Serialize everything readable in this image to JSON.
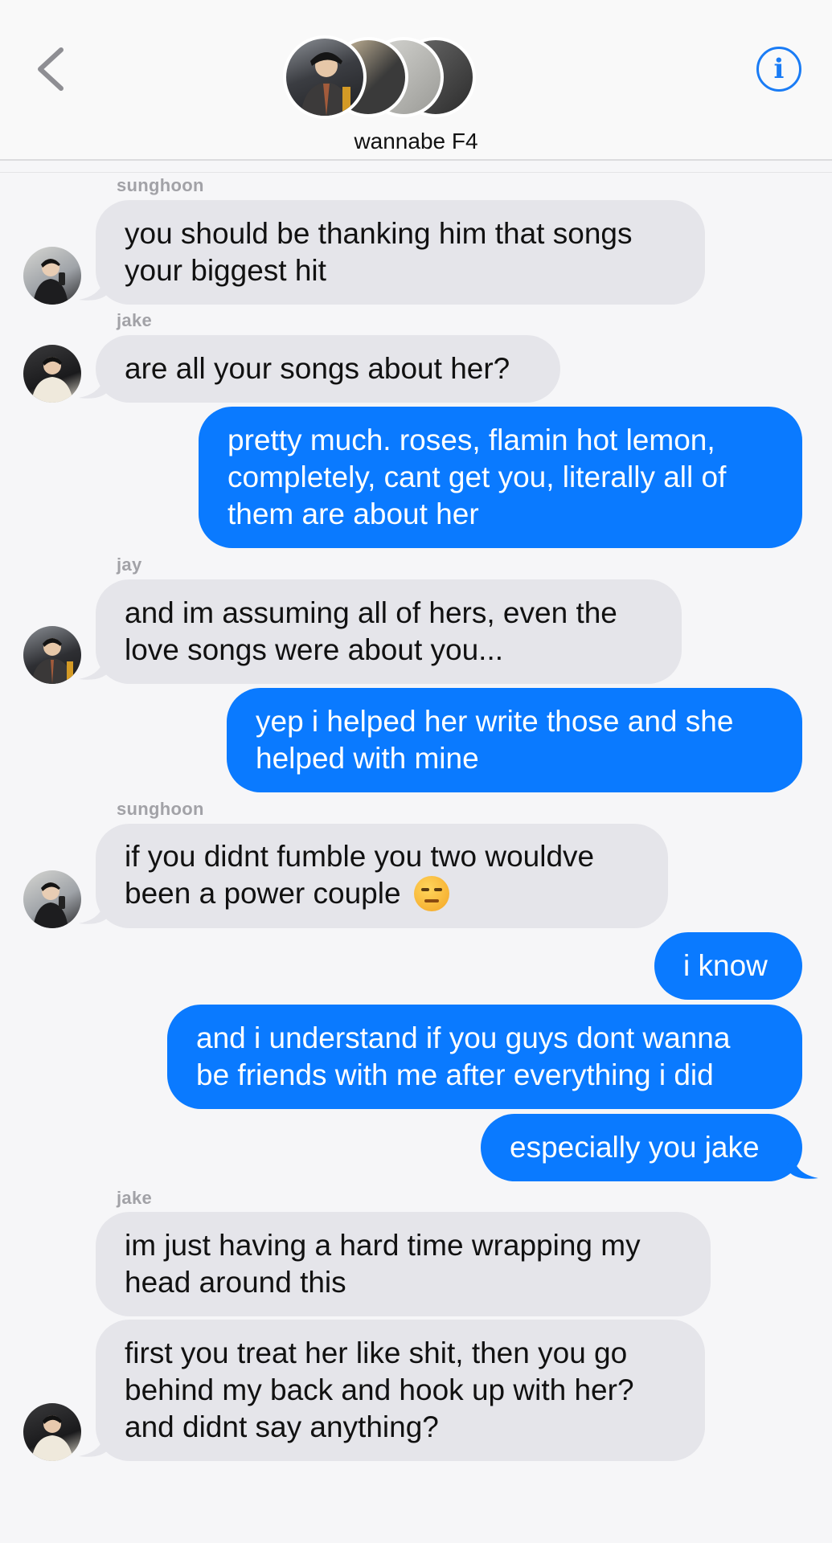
{
  "header": {
    "group_name": "wannabe F4",
    "back_icon": "chevron-left-icon",
    "info_icon": "info-icon",
    "info_glyph": "i",
    "accent_color": "#0a7aff",
    "group_avatar_count": 4
  },
  "messages": [
    {
      "sender": "sunghoon",
      "direction": "in",
      "lines": [
        "you should be thanking him that songs",
        "your biggest hit"
      ]
    },
    {
      "sender": "jake",
      "direction": "in",
      "lines": [
        "are all your songs about her?"
      ]
    },
    {
      "sender": "",
      "direction": "out",
      "lines": [
        "pretty much. roses, flamin hot lemon,",
        "completely, cant get you, literally all of",
        "them are about her"
      ]
    },
    {
      "sender": "jay",
      "direction": "in",
      "lines": [
        "and im assuming all of hers, even the",
        "love songs were about you..."
      ]
    },
    {
      "sender": "",
      "direction": "out",
      "lines": [
        "yep i helped her write those and she",
        "helped with mine"
      ]
    },
    {
      "sender": "sunghoon",
      "direction": "in",
      "lines": [
        "if you didnt fumble you two wouldve",
        "been a power couple"
      ],
      "emoji": "unamused-face-emoji"
    },
    {
      "sender": "",
      "direction": "out",
      "lines": [
        "i know"
      ]
    },
    {
      "sender": "",
      "direction": "out",
      "lines": [
        "and i understand if you guys dont wanna",
        "be friends with me after everything i did"
      ]
    },
    {
      "sender": "",
      "direction": "out",
      "lines": [
        "especially you jake"
      ]
    },
    {
      "sender": "jake",
      "direction": "in",
      "lines": [
        "im just having a hard time wrapping my",
        "head around this"
      ]
    },
    {
      "sender": "",
      "direction": "in",
      "lines": [
        "first you treat her like shit, then you go",
        "behind my back and hook up with her?",
        "and didnt say anything?"
      ]
    }
  ]
}
